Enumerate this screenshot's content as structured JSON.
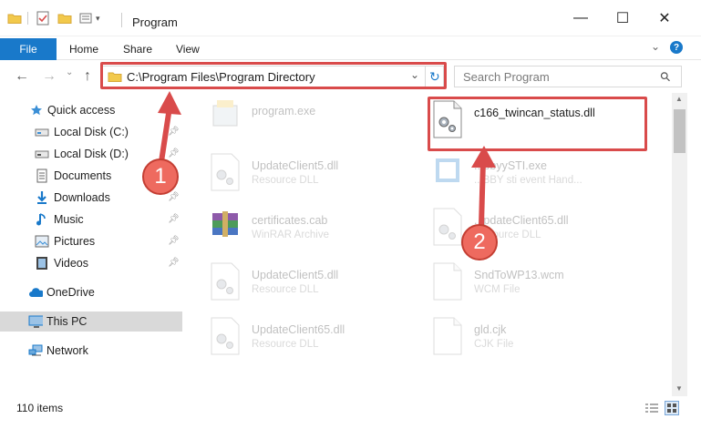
{
  "window": {
    "title": "Program",
    "minimize_glyph": "—",
    "maximize_glyph": "☐",
    "close_glyph": "✕"
  },
  "ribbon": {
    "tabs": [
      "File",
      "Home",
      "Share",
      "View"
    ],
    "expand_glyph": "⌄",
    "help_glyph": "?"
  },
  "navigation": {
    "back_glyph": "←",
    "forward_glyph": "→",
    "dropdown_glyph": "⌄",
    "up_glyph": "↑",
    "address_path": "C:\\Program Files\\Program Directory",
    "address_dropdown_glyph": "⌄",
    "refresh_glyph": "↻",
    "search_placeholder": "Search Program",
    "search_icon_glyph": "⚲"
  },
  "sidebar": {
    "items": [
      {
        "label": "Quick access",
        "icon": "star-icon",
        "pinned": false
      },
      {
        "label": "Local Disk (C:)",
        "icon": "drive-icon",
        "pinned": true
      },
      {
        "label": "Local Disk (D:)",
        "icon": "drive-icon",
        "pinned": true
      },
      {
        "label": "Documents",
        "icon": "documents-icon",
        "pinned": true
      },
      {
        "label": "Downloads",
        "icon": "download-icon",
        "pinned": true
      },
      {
        "label": "Music",
        "icon": "music-icon",
        "pinned": true
      },
      {
        "label": "Pictures",
        "icon": "pictures-icon",
        "pinned": true
      },
      {
        "label": "Videos",
        "icon": "videos-icon",
        "pinned": true
      },
      {
        "label": "OneDrive",
        "icon": "cloud-icon",
        "pinned": false
      },
      {
        "label": "This PC",
        "icon": "computer-icon",
        "pinned": false,
        "selected": true
      },
      {
        "label": "Network",
        "icon": "network-icon",
        "pinned": false
      }
    ]
  },
  "files": [
    {
      "name": "program.exe",
      "type": "",
      "icon": "program-icon"
    },
    {
      "name": "c166_twincan_status.dll",
      "type": "",
      "icon": "dll-gear-icon",
      "highlighted": true
    },
    {
      "name": "UpdateClient5.dll",
      "type": "Resource DLL",
      "icon": "dll-gear-icon"
    },
    {
      "name": "...bbyySTI.exe",
      "type": "...BBY sti event Hand...",
      "icon": "exe-icon"
    },
    {
      "name": "certificates.cab",
      "type": "WinRAR Archive",
      "icon": "archive-icon"
    },
    {
      "name": "...pdateClient65.dll",
      "type": "Resource DLL",
      "icon": "dll-gear-icon"
    },
    {
      "name": "UpdateClient5.dll",
      "type": "Resource DLL",
      "icon": "dll-gear-icon"
    },
    {
      "name": "SndToWP13.wcm",
      "type": "WCM File",
      "icon": "blank-file-icon"
    },
    {
      "name": "UpdateClient65.dll",
      "type": "Resource DLL",
      "icon": "dll-gear-icon"
    },
    {
      "name": "gld.cjk",
      "type": "CJK File",
      "icon": "blank-file-icon"
    }
  ],
  "status": {
    "item_count": "110 items"
  },
  "callouts": [
    "1",
    "2"
  ],
  "colors": {
    "accent": "#1979ca",
    "highlight_red": "#d94b4b",
    "callout_fill": "#ee6a5f",
    "selected_bg": "#d9d9d9"
  }
}
